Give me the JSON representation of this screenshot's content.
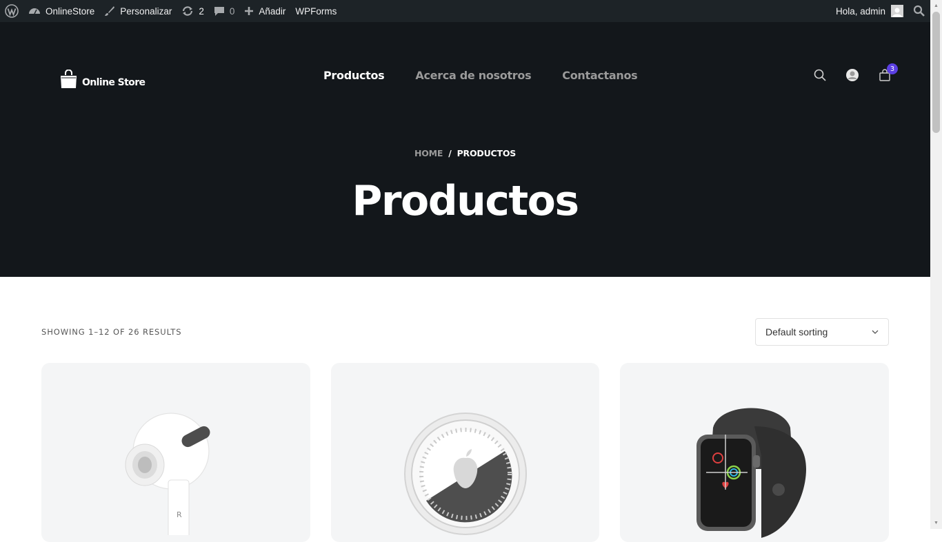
{
  "admin_bar": {
    "site_name": "OnlineStore",
    "customize": "Personalizar",
    "updates_count": "2",
    "comments_count": "0",
    "add_new": "Añadir",
    "wpforms": "WPForms",
    "greeting": "Hola, admin"
  },
  "header": {
    "logo_text": "Online Store",
    "nav": [
      "Productos",
      "Acerca de nosotros",
      "Contactanos"
    ],
    "active_nav": "Productos",
    "cart_count": "3"
  },
  "breadcrumb": {
    "home": "HOME",
    "separator": "/",
    "current": "PRODUCTOS"
  },
  "page_title": "Productos",
  "shop": {
    "result_count": "SHOWING 1–12 OF 26 RESULTS",
    "sort_selected": "Default sorting"
  },
  "products": [
    {
      "image": "airpods-pro-image"
    },
    {
      "image": "airtag-image"
    },
    {
      "image": "apple-watch-image"
    }
  ],
  "colors": {
    "admin_bar_bg": "#1d2327",
    "hero_bg": "#13171b",
    "badge_accent": "#5b3fe3",
    "card_bg": "#f4f5f6"
  }
}
